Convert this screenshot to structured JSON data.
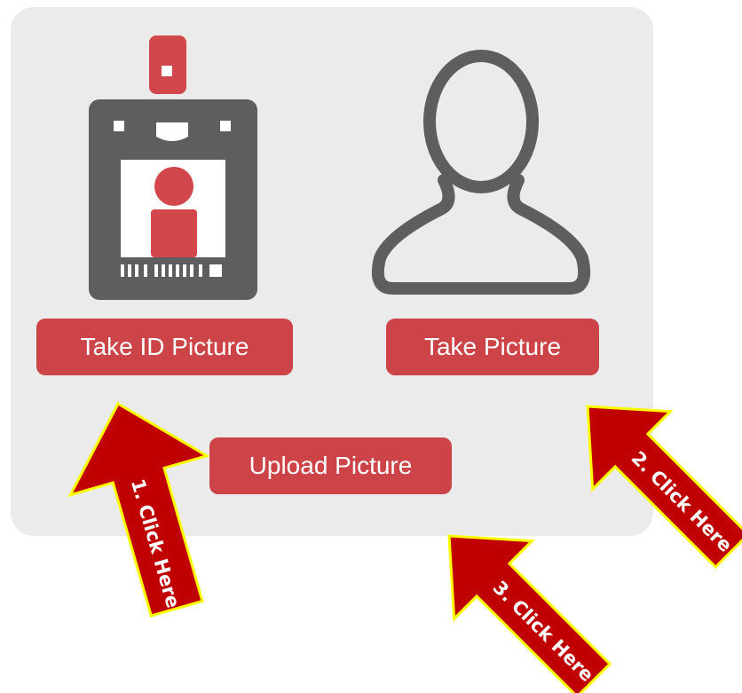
{
  "buttons": {
    "take_id_picture": "Take ID Picture",
    "take_picture": "Take Picture",
    "upload_picture": "Upload Picture"
  },
  "annotations": {
    "step1": "1. Click Here",
    "step2": "2. Click Here",
    "step3": "3. Click Here"
  },
  "icons": {
    "id_badge": "id-badge-icon",
    "person": "person-outline-icon"
  },
  "colors": {
    "panel": "#ebebeb",
    "button": "#cc4448",
    "icon_gray": "#5e5e5e",
    "arrow_fill": "#c00000",
    "arrow_outline": "#ffff00"
  }
}
